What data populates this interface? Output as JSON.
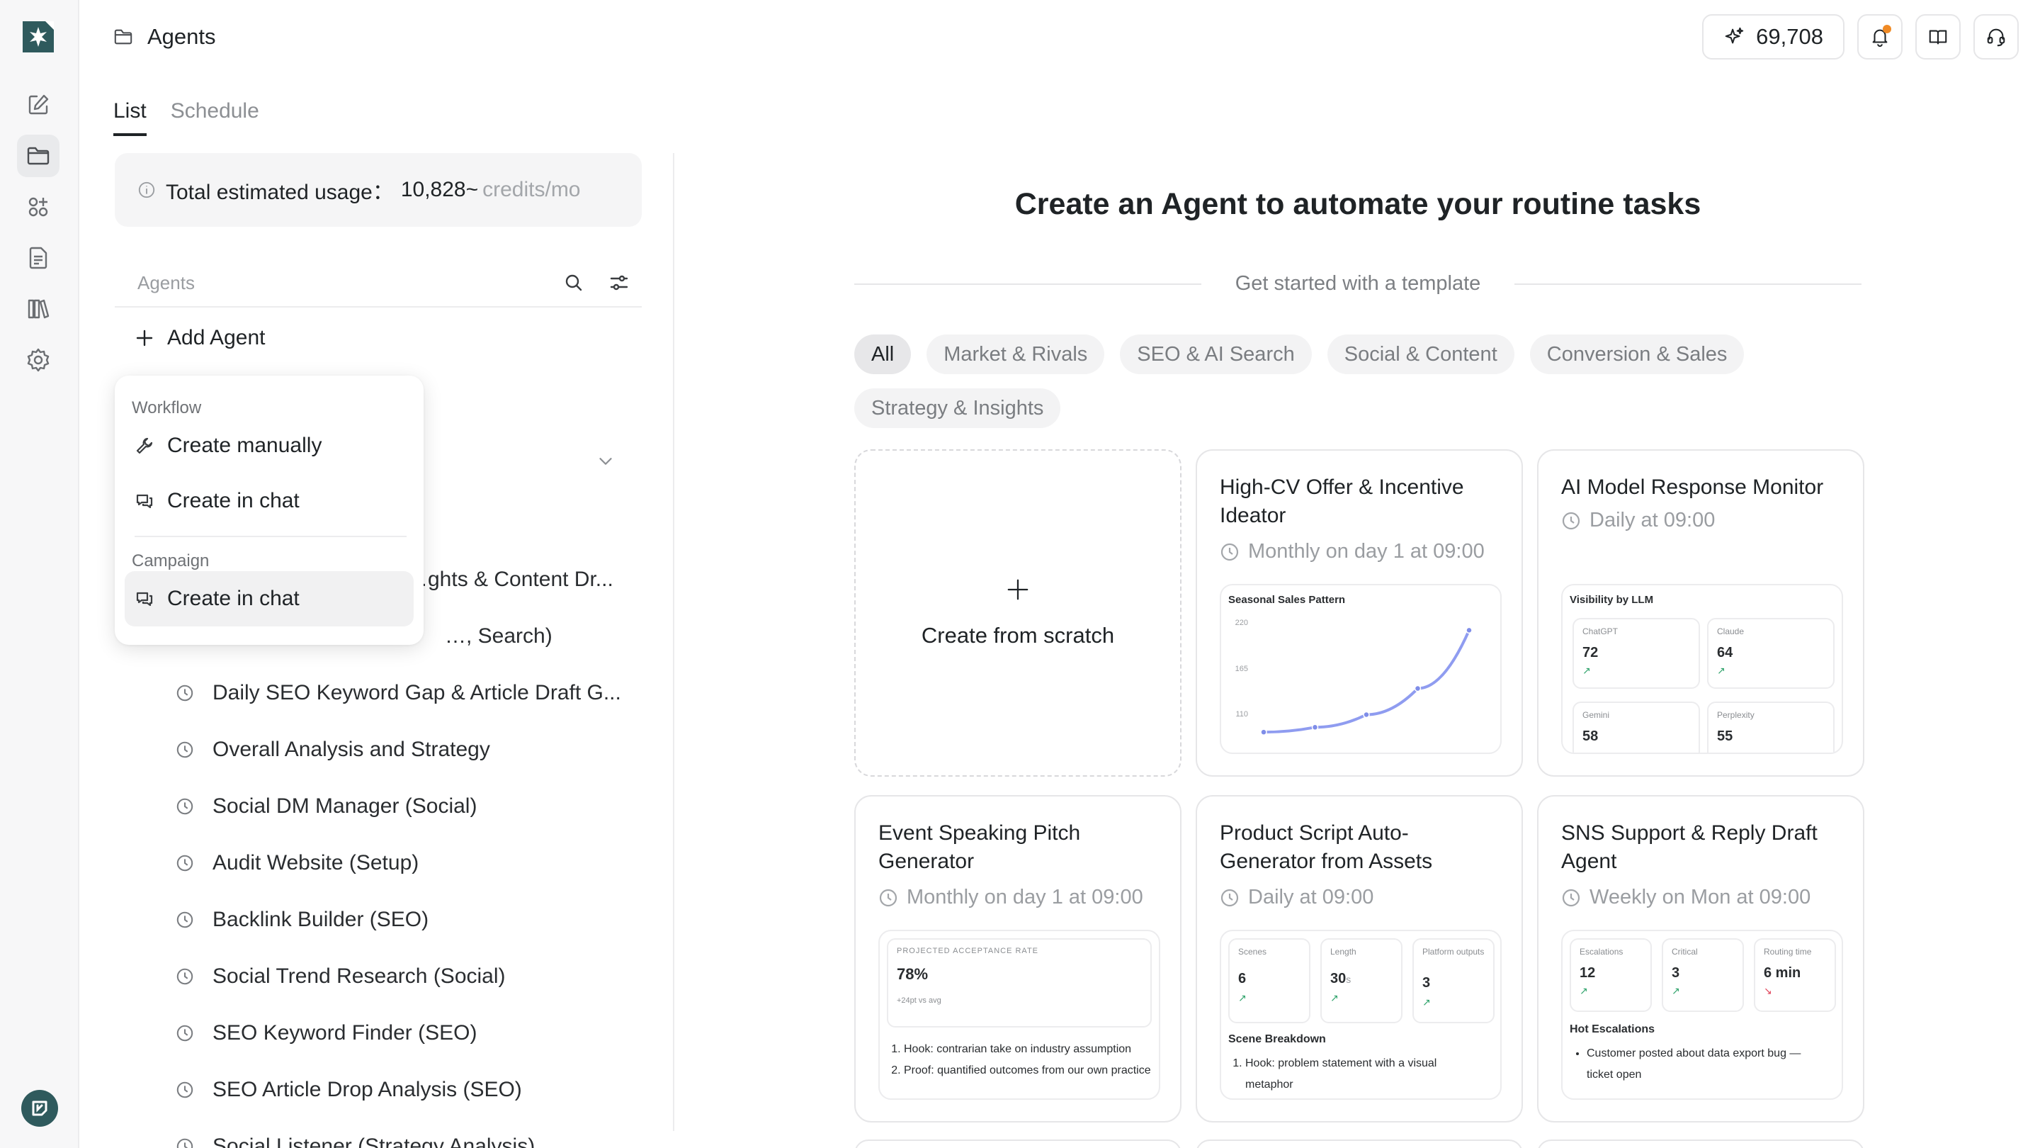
{
  "app": {
    "page_title": "Agents"
  },
  "header": {
    "credits": "69,708"
  },
  "tabs": [
    "List",
    "Schedule"
  ],
  "usage": {
    "label": "Total estimated usage：",
    "value": "10,828~",
    "unit": "credits/mo"
  },
  "agents_panel": {
    "label": "Agents",
    "add_label": "Add Agent",
    "items": [
      "…ghts & Content Dr...",
      "…, Search)",
      "Daily SEO Keyword Gap & Article Draft G...",
      "Overall Analysis and Strategy",
      "Social DM Manager (Social)",
      "Audit Website (Setup)",
      "Backlink Builder (SEO)",
      "Social Trend Research (Social)",
      "SEO Keyword Finder (SEO)",
      "SEO Article Drop Analysis (SEO)",
      "Social Listener (Strategy Analysis)"
    ]
  },
  "menu": {
    "workflow_label": "Workflow",
    "create_manually": "Create manually",
    "create_in_chat": "Create in chat",
    "campaign_label": "Campaign",
    "campaign_create_in_chat": "Create in chat"
  },
  "main": {
    "title": "Create an Agent to automate your routine tasks",
    "template_label": "Get started with a template",
    "filters": [
      "All",
      "Market & Rivals",
      "SEO & AI Search",
      "Social & Content",
      "Conversion & Sales",
      "Strategy & Insights"
    ],
    "scratch_label": "Create from scratch"
  },
  "cards": [
    {
      "title": "High-CV Offer & Incentive Ideator",
      "schedule": "Monthly on day 1 at 09:00",
      "preview": {
        "title": "Seasonal Sales Pattern",
        "y_ticks": [
          "220",
          "165",
          "110"
        ]
      }
    },
    {
      "title": "AI Model Response Monitor",
      "schedule": "Daily at 09:00",
      "preview": {
        "title": "Visibility by LLM",
        "metrics": [
          {
            "label": "ChatGPT",
            "value": "72",
            "trend": "↗"
          },
          {
            "label": "Claude",
            "value": "64",
            "trend": "↗"
          },
          {
            "label": "Gemini",
            "value": "58"
          },
          {
            "label": "Perplexity",
            "value": "55"
          }
        ]
      }
    },
    {
      "title": "Event Speaking Pitch Generator",
      "schedule": "Monthly on day 1 at 09:00",
      "preview": {
        "metric_label": "PROJECTED ACCEPTANCE RATE",
        "metric_value": "78%",
        "metric_note": "+24pt vs avg",
        "list": [
          "Hook: contrarian take on industry assumption",
          "Proof: quantified outcomes from our own practice"
        ]
      }
    },
    {
      "title": "Product Script Auto-Generator from Assets",
      "schedule": "Daily at 09:00",
      "preview": {
        "metrics": [
          {
            "label": "Scenes",
            "value": "6",
            "unit": "",
            "trend": "↗"
          },
          {
            "label": "Length",
            "value": "30",
            "unit": "s",
            "trend": "↗"
          },
          {
            "label": "Platform outputs",
            "value": "3",
            "unit": "",
            "trend": "↗"
          }
        ],
        "section": "Scene Breakdown",
        "list": [
          "Hook: problem statement with a visual metaphor"
        ]
      }
    },
    {
      "title": "SNS Support & Reply Draft Agent",
      "schedule": "Weekly on Mon at 09:00",
      "preview": {
        "metrics": [
          {
            "label": "Escalations",
            "value": "12",
            "trend": "↗"
          },
          {
            "label": "Critical",
            "value": "3",
            "trend": "↗"
          },
          {
            "label": "Routing time",
            "value": "6 min",
            "trend": "↘"
          }
        ],
        "section": "Hot Escalations",
        "list": [
          "Customer posted about data export bug — ticket open"
        ]
      }
    }
  ],
  "chart_data": {
    "type": "line",
    "title": "Seasonal Sales Pattern",
    "x": [
      1,
      2,
      3,
      4,
      5
    ],
    "y": [
      100,
      105,
      118,
      145,
      205
    ],
    "ylim": [
      95,
      225
    ],
    "y_ticks": [
      110,
      165,
      220
    ]
  }
}
